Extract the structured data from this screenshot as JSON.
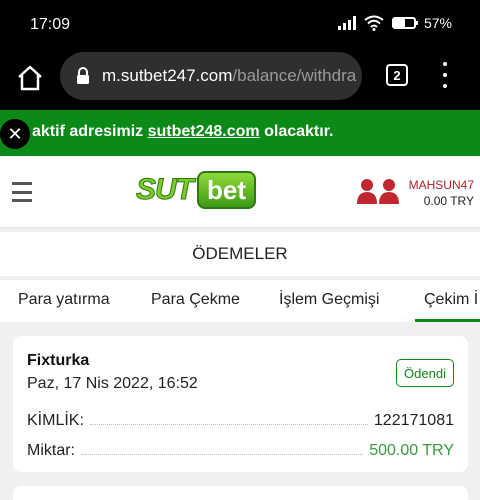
{
  "status_bar": {
    "time": "17:09",
    "battery": "57%",
    "battery_level": 0.57
  },
  "browser": {
    "url_host": "m.sutbet247.com",
    "url_path": "/balance/withdra",
    "tab_count": "2"
  },
  "notice": {
    "prefix": "aktif adresimiz ",
    "link": "sutbet248.com",
    "suffix": " olacaktır."
  },
  "header": {
    "logo_left": "SUT",
    "logo_right": "bet",
    "username": "MAHSUN47",
    "balance": "0.00 TRY"
  },
  "page_title": "ÖDEMELER",
  "tabs": [
    {
      "label": "Para yatırma"
    },
    {
      "label": "Para Çekme"
    },
    {
      "label": "İşlem Geçmişi"
    },
    {
      "label": "Çekim İ"
    }
  ],
  "transaction": {
    "method": "Fixturka",
    "date": "Paz, 17 Nis 2022, 16:52",
    "status": "Ödendi",
    "id_label": "KİMLİK:",
    "id_value": "122171081",
    "amount_label": "Miktar:",
    "amount_value": "500.00 TRY"
  },
  "colors": {
    "brand_green": "#0b8a17",
    "username_red": "#b3202b",
    "amount_green": "#3a9a3f"
  }
}
